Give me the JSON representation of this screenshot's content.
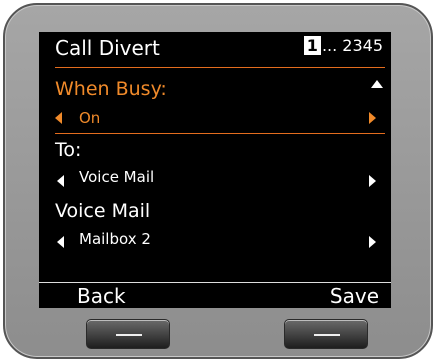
{
  "screen": {
    "title": "Call Divert",
    "pager": {
      "current": "1",
      "rest": "... 2345"
    }
  },
  "settings": [
    {
      "label": "When Busy:",
      "value": "On",
      "selected": true
    },
    {
      "label": "To:",
      "value": "Voice Mail",
      "selected": false
    },
    {
      "label": "Voice Mail",
      "value": "Mailbox 2",
      "selected": false
    }
  ],
  "softkeys": {
    "left": "Back",
    "right": "Save"
  },
  "colors": {
    "accent": "#f08a2a",
    "screen_bg": "#000000",
    "bezel": "#9a9a9a"
  },
  "icons": [
    "scroll-up-icon",
    "arrow-left-icon",
    "arrow-right-icon",
    "key-bar-icon"
  ]
}
